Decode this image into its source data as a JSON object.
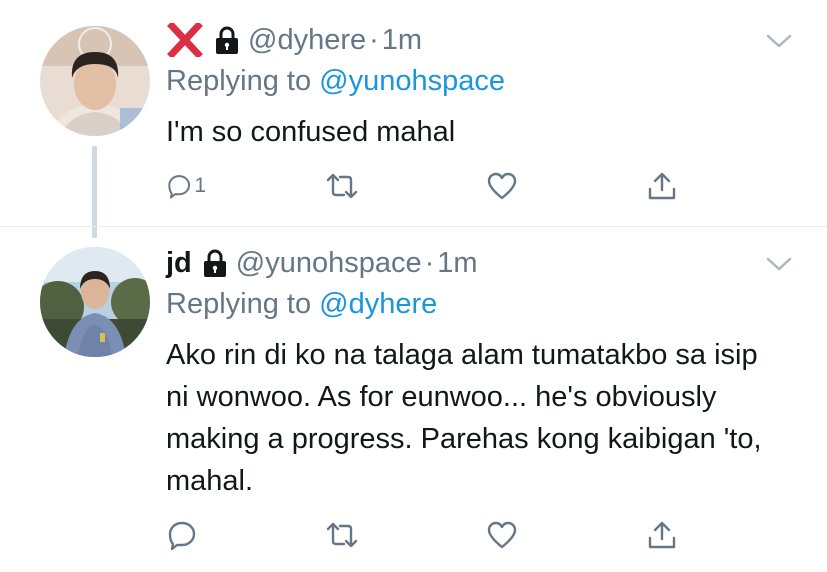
{
  "tweets": [
    {
      "name": "",
      "name_icon": "red-x-emoji",
      "locked": true,
      "handle": "@dyhere",
      "separator": "·",
      "time": "1m",
      "replying_prefix": "Replying to ",
      "replying_to": "@yunohspace",
      "text": "I'm so confused mahal",
      "reply_count": "1",
      "avatar_colors": [
        "#c9a98f",
        "#2b2421",
        "#e7d2c1"
      ]
    },
    {
      "name": "jd",
      "locked": true,
      "handle": "@yunohspace",
      "separator": "·",
      "time": "1m",
      "replying_prefix": "Replying to ",
      "replying_to": "@dyhere",
      "text": "Ako rin di ko na talaga alam tumatakbo sa isip ni wonwoo. As for eunwoo... he's obviously making a progress. Parehas kong kaibigan 'to, mahal.",
      "reply_count": "",
      "avatar_colors": [
        "#9db8c9",
        "#3d4a35",
        "#6f83a8"
      ]
    }
  ],
  "icons": {
    "reply": "reply-icon",
    "retweet": "retweet-icon",
    "like": "heart-icon",
    "share": "share-icon",
    "menu": "chevron-down-icon",
    "lock": "lock-icon"
  },
  "colors": {
    "link": "#1b95e0",
    "secondary": "#657786",
    "text": "#14171a",
    "x_red": "#dd2e44"
  }
}
